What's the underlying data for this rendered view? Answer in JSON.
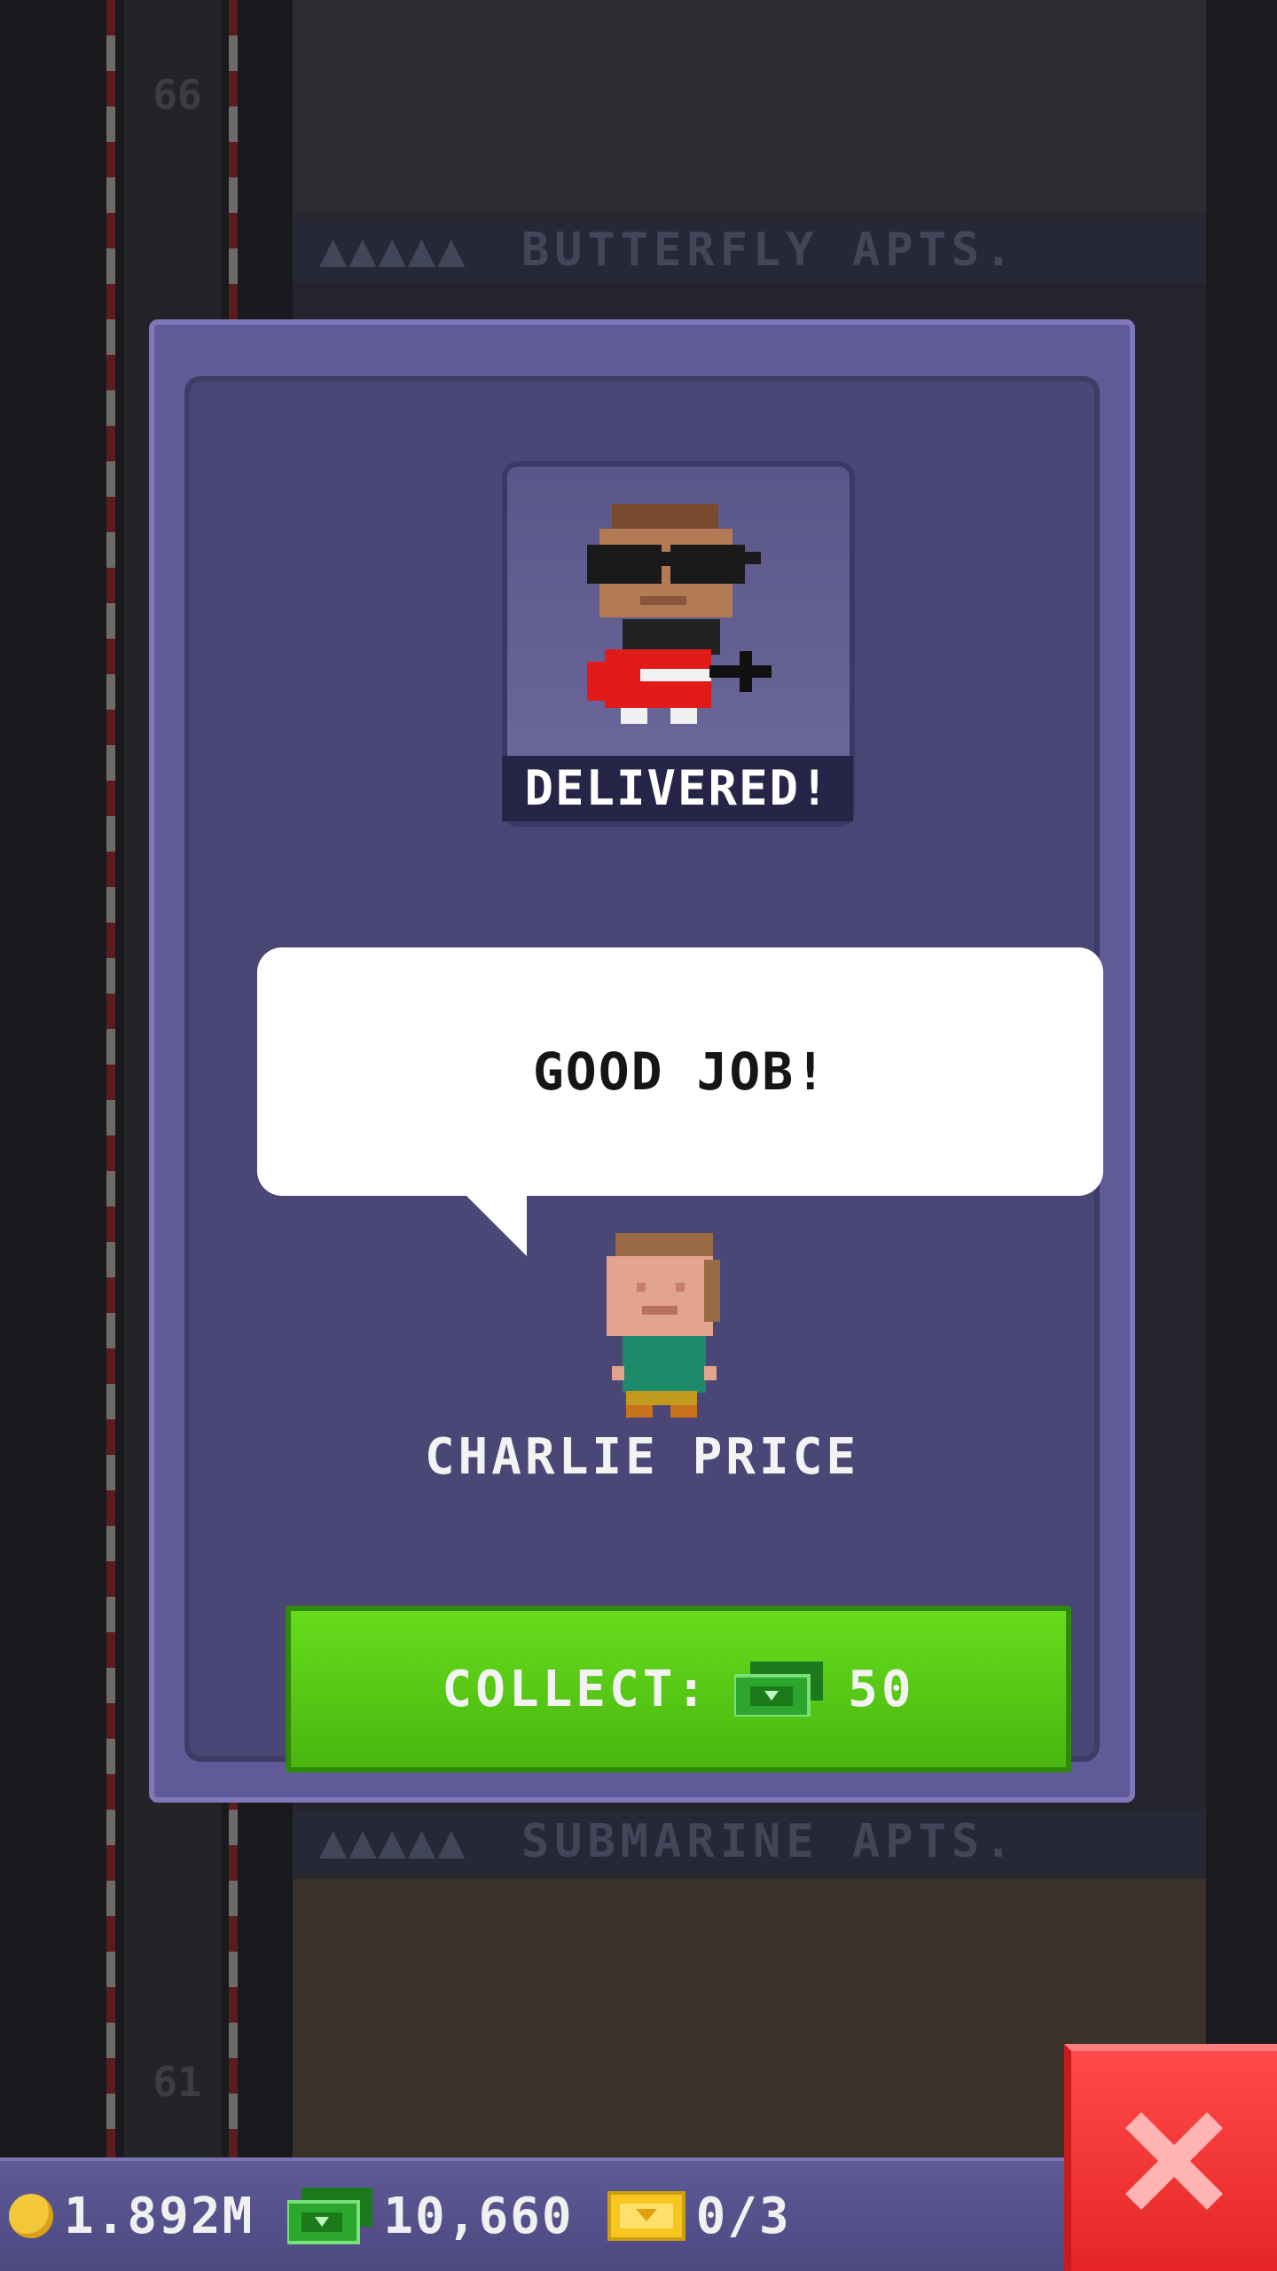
{
  "background": {
    "floors": [
      {
        "label": "BUTTERFLY APTS.",
        "number": "66"
      },
      {
        "label": "SUBMARINE APTS.",
        "number": "61"
      }
    ],
    "floor_pips": "▲▲▲▲▲"
  },
  "modal": {
    "status": "DELIVERED!",
    "speech": "GOOD JOB!",
    "character_name": "CHARLIE PRICE",
    "collect_label": "COLLECT:",
    "collect_amount": "50"
  },
  "bottom_bar": {
    "coins": "1.892M",
    "bux": "10,660",
    "tickets": "0/3"
  },
  "colors": {
    "modal_frame": "#615a99",
    "modal_inner": "#4a4676",
    "collect_green": "#5ccc16",
    "close_red": "#ff3b3b",
    "bottom_bar": "#5a5590"
  },
  "icons": [
    "coin-icon",
    "bux-icon",
    "ticket-icon",
    "close-icon",
    "bellhop-sprite",
    "resident-sprite"
  ]
}
